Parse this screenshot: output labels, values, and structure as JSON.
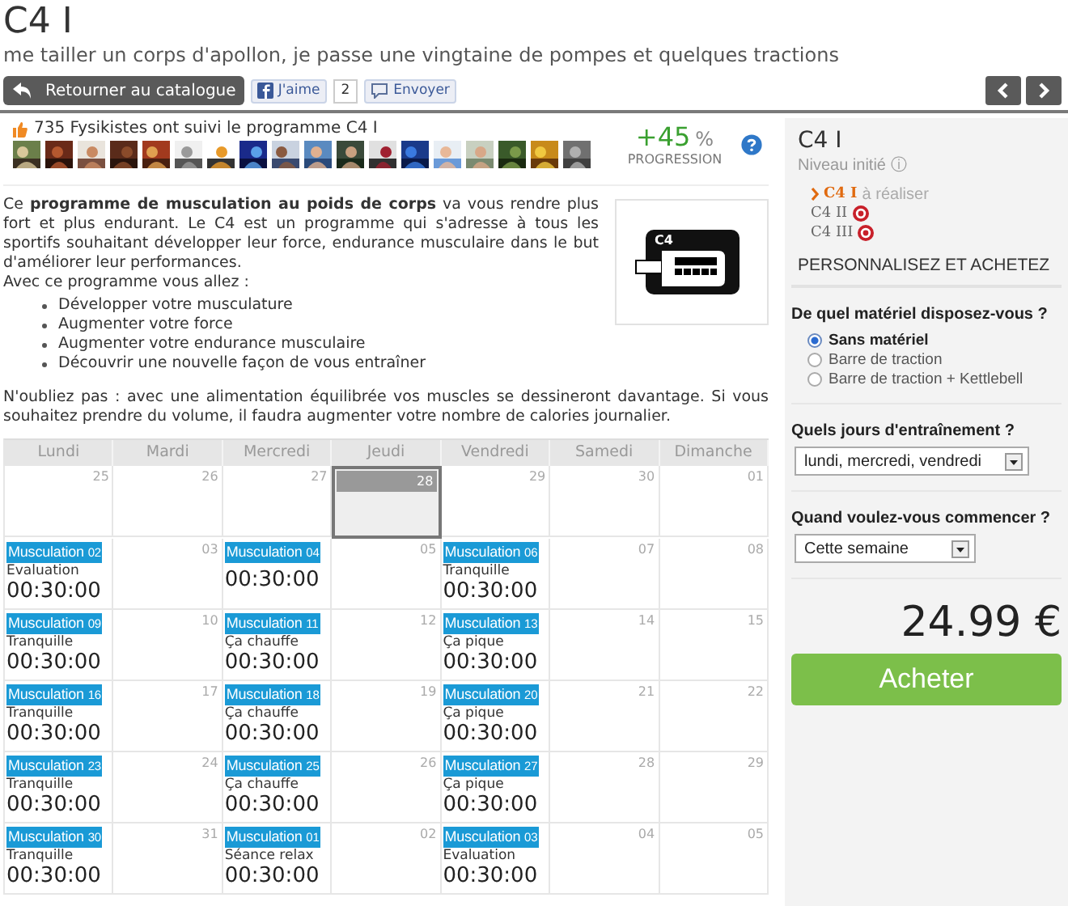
{
  "title": "C4 I",
  "subtitle": "me tailler un corps d'apollon, je passe une vingtaine de pompes et quelques tractions",
  "toolbar": {
    "back": "Retourner au catalogue",
    "like": "J'aime",
    "like_count": "2",
    "send": "Envoyer"
  },
  "followers": {
    "text": "735 Fysikistes ont suivi le programme C4 I"
  },
  "progress": {
    "value": "+45",
    "unit": "%",
    "label": "PROGRESSION"
  },
  "description": {
    "intro": "Ce **programme de musculation au poids de corps** va vous rendre plus fort et plus endurant. Le C4 est un programme qui s'adresse à tous les sportifs souhaitant développer leur force, endurance musculaire dans le but d'améliorer leur performances.",
    "lead": "Avec ce programme vous allez :",
    "bullets": [
      "Développer votre musculature",
      "Augmenter votre force",
      "Augmenter votre endurance musculaire",
      "Découvrir une nouvelle façon de vous entraîner"
    ],
    "note": "N'oubliez pas : avec une alimentation équilibrée vos muscles se dessineront davantage. Si vous souhaitez prendre du volume, il faudra augmenter votre nombre de calories journalier.",
    "image_label": "C4"
  },
  "calendar": {
    "weekdays": [
      "Lundi",
      "Mardi",
      "Mercredi",
      "Jeudi",
      "Vendredi",
      "Samedi",
      "Dimanche"
    ],
    "weeks": [
      [
        {
          "day": "25",
          "today": false
        },
        {
          "day": "26",
          "today": false
        },
        {
          "day": "27",
          "today": false
        },
        {
          "day": "28",
          "today": true
        },
        {
          "day": "29",
          "today": false
        },
        {
          "day": "30",
          "today": false
        },
        {
          "day": "01",
          "today": false
        }
      ],
      [
        {
          "day": "02",
          "today": false,
          "session": {
            "label": "Musculation",
            "intensity": "Evaluation",
            "duration": "00:30:00"
          }
        },
        {
          "day": "03",
          "today": false
        },
        {
          "day": "04",
          "today": false,
          "session": {
            "label": "Musculation",
            "duration": "00:30:00"
          }
        },
        {
          "day": "05",
          "today": false
        },
        {
          "day": "06",
          "today": false,
          "session": {
            "label": "Musculation",
            "intensity": "Tranquille",
            "duration": "00:30:00"
          }
        },
        {
          "day": "07",
          "today": false
        },
        {
          "day": "08",
          "today": false
        }
      ],
      [
        {
          "day": "09",
          "today": false,
          "session": {
            "label": "Musculation",
            "intensity": "Tranquille",
            "duration": "00:30:00"
          }
        },
        {
          "day": "10",
          "today": false
        },
        {
          "day": "11",
          "today": false,
          "session": {
            "label": "Musculation",
            "intensity": "Ça chauffe",
            "duration": "00:30:00"
          }
        },
        {
          "day": "12",
          "today": false
        },
        {
          "day": "13",
          "today": false,
          "session": {
            "label": "Musculation",
            "intensity": "Ça pique",
            "duration": "00:30:00"
          }
        },
        {
          "day": "14",
          "today": false
        },
        {
          "day": "15",
          "today": false
        }
      ],
      [
        {
          "day": "16",
          "today": false,
          "session": {
            "label": "Musculation",
            "intensity": "Tranquille",
            "duration": "00:30:00"
          }
        },
        {
          "day": "17",
          "today": false
        },
        {
          "day": "18",
          "today": false,
          "session": {
            "label": "Musculation",
            "intensity": "Ça chauffe",
            "duration": "00:30:00"
          }
        },
        {
          "day": "19",
          "today": false
        },
        {
          "day": "20",
          "today": false,
          "session": {
            "label": "Musculation",
            "intensity": "Ça pique",
            "duration": "00:30:00"
          }
        },
        {
          "day": "21",
          "today": false
        },
        {
          "day": "22",
          "today": false
        }
      ],
      [
        {
          "day": "23",
          "today": false,
          "session": {
            "label": "Musculation",
            "intensity": "Tranquille",
            "duration": "00:30:00"
          }
        },
        {
          "day": "24",
          "today": false
        },
        {
          "day": "25",
          "today": false,
          "session": {
            "label": "Musculation",
            "intensity": "Ça chauffe",
            "duration": "00:30:00"
          }
        },
        {
          "day": "26",
          "today": false
        },
        {
          "day": "27",
          "today": false,
          "session": {
            "label": "Musculation",
            "intensity": "Ça pique",
            "duration": "00:30:00"
          }
        },
        {
          "day": "28",
          "today": false
        },
        {
          "day": "29",
          "today": false
        }
      ],
      [
        {
          "day": "30",
          "today": false,
          "session": {
            "label": "Musculation",
            "intensity": "Tranquille",
            "duration": "00:30:00"
          }
        },
        {
          "day": "31",
          "today": false
        },
        {
          "day": "01",
          "today": false,
          "session": {
            "label": "Musculation",
            "intensity": "Séance relax",
            "duration": "00:30:00"
          }
        },
        {
          "day": "02",
          "today": false
        },
        {
          "day": "03",
          "today": false,
          "session": {
            "label": "Musculation",
            "intensity": "Evaluation",
            "duration": "00:30:00"
          }
        },
        {
          "day": "04",
          "today": false
        },
        {
          "day": "05",
          "today": false
        }
      ]
    ]
  },
  "sidebar": {
    "title": "C4 I",
    "level": "Niveau initié ⓘ",
    "programs": [
      {
        "label": "C4 I",
        "note": "à réaliser",
        "selected": true,
        "locked": false
      },
      {
        "label": "C4 II",
        "selected": false,
        "locked": true
      },
      {
        "label": "C4 III",
        "selected": false,
        "locked": true
      }
    ],
    "heading": "PERSONNALISEZ ET ACHETEZ",
    "equipment": {
      "question": "De quel matériel disposez-vous ?",
      "options": [
        {
          "label": "Sans matériel",
          "selected": true
        },
        {
          "label": "Barre de traction",
          "selected": false
        },
        {
          "label": "Barre de traction + Kettlebell",
          "selected": false
        }
      ]
    },
    "days": {
      "question": "Quels jours d'entraînement ?",
      "value": "lundi, mercredi, vendredi"
    },
    "start": {
      "question": "Quand voulez-vous commencer ?",
      "value": "Cette semaine"
    },
    "price": "24.99 €",
    "buy": "Acheter"
  }
}
